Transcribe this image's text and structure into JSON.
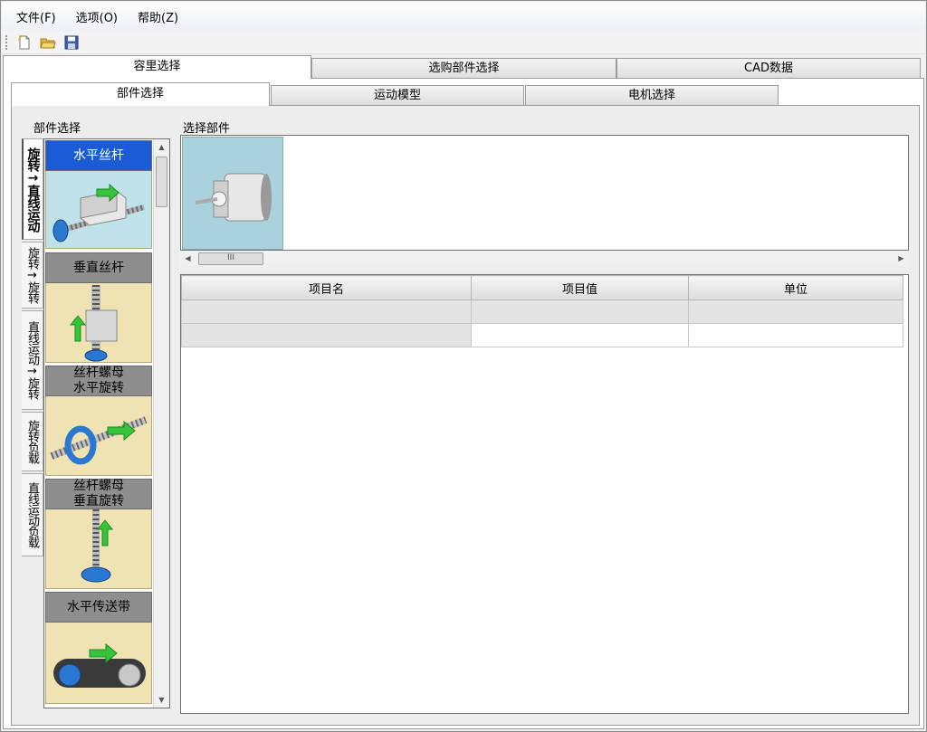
{
  "menu": {
    "items": [
      "文件(F)",
      "选项(O)",
      "帮助(Z)"
    ]
  },
  "toolbar": {
    "buttons": [
      "new-file-icon",
      "open-folder-icon",
      "save-disk-icon"
    ]
  },
  "colors": {
    "selected_title": "#1b5bd6",
    "part_bg": "#efe3b4",
    "selected_bg": "#bfe1ea"
  },
  "outer_tabs": {
    "t0": "容里选择",
    "t1": "选购部件选择",
    "t2": "CAD数据"
  },
  "inner_tabs": {
    "t0": "部件选择",
    "t1": "运动模型",
    "t2": "电机选择"
  },
  "left_group_label": "部件选择",
  "right_group_label": "选择部件",
  "categories": [
    "旋转→直线运动",
    "旋转→旋转",
    "直线运动→旋转",
    "旋转负载",
    "直线运动负载"
  ],
  "parts": [
    {
      "title": "水平丝杆",
      "selected": true
    },
    {
      "title": "垂直丝杆"
    },
    {
      "title": "丝杆螺母\n水平旋转"
    },
    {
      "title": "丝杆螺母\n垂直旋转"
    },
    {
      "title": "水平传送带"
    }
  ],
  "table": {
    "headers": [
      "项目名",
      "项目值",
      "单位"
    ],
    "rows": [
      [
        "",
        "",
        ""
      ],
      [
        "",
        "",
        ""
      ]
    ]
  }
}
